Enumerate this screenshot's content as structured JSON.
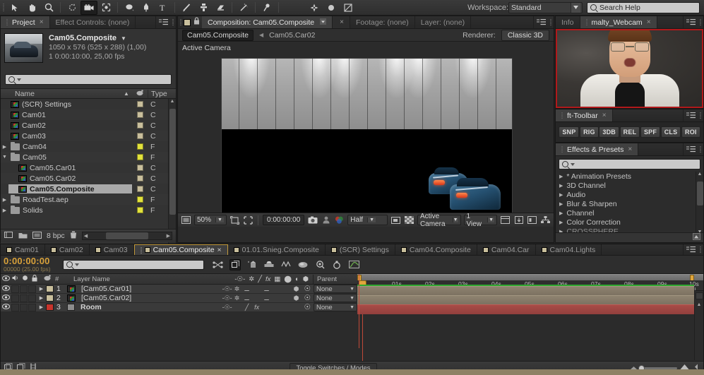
{
  "app": {
    "workspace_label": "Workspace:",
    "workspace_value": "Standard",
    "search_help_placeholder": "Search Help"
  },
  "toolbar": {
    "tools": [
      {
        "name": "selection-tool",
        "glyph": "↖"
      },
      {
        "name": "hand-tool",
        "glyph": "✋"
      },
      {
        "name": "zoom-tool",
        "glyph": "⌕"
      },
      {
        "name": "rotation-tool",
        "glyph": "↻"
      },
      {
        "name": "camera-tool",
        "glyph": "▣"
      },
      {
        "name": "pan-behind-tool",
        "glyph": "✧"
      },
      {
        "name": "shape-tool",
        "glyph": "⬬"
      },
      {
        "name": "pen-tool",
        "glyph": "✒"
      },
      {
        "name": "type-tool",
        "glyph": "T"
      },
      {
        "name": "brush-tool",
        "glyph": "╱"
      },
      {
        "name": "clone-stamp-tool",
        "glyph": "⚓"
      },
      {
        "name": "eraser-tool",
        "glyph": "▭"
      },
      {
        "name": "roto-brush-tool",
        "glyph": "✐"
      },
      {
        "name": "puppet-pin-tool",
        "glyph": "⁕"
      },
      {
        "name": "unified-camera-tool",
        "glyph": "✤"
      },
      {
        "name": "orbit-camera-tool",
        "glyph": "●"
      },
      {
        "name": "track-camera-tool",
        "glyph": "⧉"
      }
    ]
  },
  "project": {
    "tabs": [
      {
        "label": "Project",
        "active": true,
        "closeable": true
      },
      {
        "label": "Effect Controls: (none)",
        "active": false,
        "closeable": false
      }
    ],
    "comp_name": "Cam05.Composite",
    "comp_dims": "1050 x 576  (525 x 288) (1,00)",
    "comp_duration": "1 0:00:10:00, 25,00 fps",
    "search_placeholder": "",
    "columns": {
      "name": "Name",
      "type": "Type"
    },
    "items": [
      {
        "label": "(SCR) Settings",
        "icon": "comp-icon",
        "indent": 0,
        "twirl": "",
        "color": "#c9bf9c",
        "type": "C",
        "selected": false
      },
      {
        "label": "Cam01",
        "icon": "comp-icon",
        "indent": 0,
        "twirl": "",
        "color": "#c9bf9c",
        "type": "C",
        "selected": false
      },
      {
        "label": "Cam02",
        "icon": "comp-icon",
        "indent": 0,
        "twirl": "",
        "color": "#c9bf9c",
        "type": "C",
        "selected": false
      },
      {
        "label": "Cam03",
        "icon": "comp-icon",
        "indent": 0,
        "twirl": "",
        "color": "#c9bf9c",
        "type": "C",
        "selected": false
      },
      {
        "label": "Cam04",
        "icon": "folder-icon",
        "indent": 0,
        "twirl": "▶",
        "color": "#e2e23c",
        "type": "F",
        "selected": false
      },
      {
        "label": "Cam05",
        "icon": "folder-icon",
        "indent": 0,
        "twirl": "▼",
        "color": "#e2e23c",
        "type": "F",
        "selected": false
      },
      {
        "label": "Cam05.Car01",
        "icon": "comp-icon",
        "indent": 1,
        "twirl": "",
        "color": "#c9bf9c",
        "type": "C",
        "selected": false
      },
      {
        "label": "Cam05.Car02",
        "icon": "comp-icon",
        "indent": 1,
        "twirl": "",
        "color": "#c9bf9c",
        "type": "C",
        "selected": false
      },
      {
        "label": "Cam05.Composite",
        "icon": "comp-icon",
        "indent": 1,
        "twirl": "",
        "color": "#c9bf9c",
        "type": "C",
        "selected": true
      },
      {
        "label": "RoadTest.aep",
        "icon": "folder-icon",
        "indent": 0,
        "twirl": "▶",
        "color": "#e2e23c",
        "type": "F",
        "selected": false
      },
      {
        "label": "Solids",
        "icon": "folder-icon",
        "indent": 0,
        "twirl": "▶",
        "color": "#e2e23c",
        "type": "F",
        "selected": false
      }
    ],
    "footer": {
      "bit_depth": "8 bpc"
    }
  },
  "composition": {
    "tabs": [
      {
        "label": "Composition: Cam05.Composite",
        "active": true
      },
      {
        "label": "Footage: (none)",
        "active": false
      },
      {
        "label": "Layer: (none)",
        "active": false
      }
    ],
    "breadcrumb_active": "Cam05.Composite",
    "breadcrumb_next": "Cam05.Car02",
    "renderer_label": "Renderer:",
    "renderer_value": "Classic 3D",
    "view_label": "Active Camera",
    "footer": {
      "zoom": "50%",
      "time": "0:00:00:00",
      "resolution": "Half",
      "camera": "Active Camera",
      "views": "1 View"
    }
  },
  "info_panel": {
    "tabs": [
      {
        "label": "Info",
        "active": false
      },
      {
        "label": "malty_Webcam",
        "active": true
      }
    ]
  },
  "ft_toolbar": {
    "tab_label": "ft-Toolbar",
    "buttons": [
      "SNP",
      "RIG",
      "3DB",
      "REL",
      "SPF",
      "CLS",
      "ROI"
    ]
  },
  "effects_panel": {
    "tab_label": "Effects & Presets",
    "search_placeholder": "",
    "categories": [
      "* Animation Presets",
      "3D Channel",
      "Audio",
      "Blur & Sharpen",
      "Channel",
      "Color Correction",
      "CROSSPHERE"
    ]
  },
  "timeline": {
    "tabs": [
      {
        "label": "Cam01",
        "active": false
      },
      {
        "label": "Cam02",
        "active": false
      },
      {
        "label": "Cam03",
        "active": false
      },
      {
        "label": "Cam05.Composite",
        "active": true
      },
      {
        "label": "01.01.Snieg.Composite",
        "active": false
      },
      {
        "label": "(SCR) Settings",
        "active": false
      },
      {
        "label": "Cam04.Composite",
        "active": false
      },
      {
        "label": "Cam04.Car",
        "active": false
      },
      {
        "label": "Cam04.Lights",
        "active": false
      }
    ],
    "current_time": "0:00:00:00",
    "frame_info": "00000 (25.00 fps)",
    "search_placeholder": "",
    "columns": {
      "layer_name": "Layer Name",
      "parent": "Parent"
    },
    "ruler_ticks": [
      "0s",
      "01s",
      "02s",
      "03s",
      "04s",
      "05s",
      "06s",
      "07s",
      "08s",
      "09s",
      "10s"
    ],
    "layers": [
      {
        "index": "1",
        "name": "[Cam05.Car01]",
        "color": "#c9bf9c",
        "bar_color": "#8c8068",
        "icon": "comp-icon",
        "parent": "None"
      },
      {
        "index": "2",
        "name": "[Cam05.Car02]",
        "color": "#c9bf9c",
        "bar_color": "#8c8068",
        "icon": "comp-icon",
        "parent": "None"
      },
      {
        "index": "3",
        "name": "Room",
        "color": "#c9352c",
        "bar_color": "#a0413f",
        "icon": "solid-icon",
        "parent": "None"
      }
    ],
    "footer": {
      "toggle_label": "Toggle Switches / Modes"
    }
  },
  "colors": {
    "accent_orange": "#d8a13a",
    "webcam_border": "#b0191b",
    "label_beige": "#c9bf9c",
    "label_yellow": "#e2e23c",
    "label_red": "#c9352c",
    "panel_bg": "#262626"
  }
}
